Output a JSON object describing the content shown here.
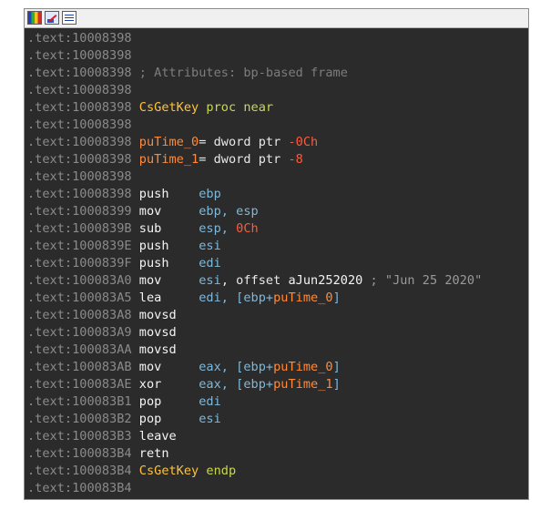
{
  "toolbar": {
    "icons": [
      "graph-view-icon",
      "edit-icon",
      "text-view-icon"
    ]
  },
  "lines": [
    {
      "addr": ".text:10008398",
      "parts": []
    },
    {
      "addr": ".text:10008398",
      "parts": []
    },
    {
      "addr": ".text:10008398",
      "parts": [
        {
          "t": " ; Attributes: bp-based frame",
          "c": "c-cmt"
        }
      ]
    },
    {
      "addr": ".text:10008398",
      "parts": []
    },
    {
      "addr": ".text:10008398",
      "parts": [
        {
          "t": " ",
          "c": "c-plain"
        },
        {
          "t": "CsGetKey",
          "c": "c-name"
        },
        {
          "t": " proc near",
          "c": "c-kw"
        }
      ]
    },
    {
      "addr": ".text:10008398",
      "parts": []
    },
    {
      "addr": ".text:10008398",
      "parts": [
        {
          "t": " ",
          "c": "c-plain"
        },
        {
          "t": "puTime_0",
          "c": "c-var"
        },
        {
          "t": "= dword ptr ",
          "c": "c-plain"
        },
        {
          "t": "-0Ch",
          "c": "c-neg"
        }
      ]
    },
    {
      "addr": ".text:10008398",
      "parts": [
        {
          "t": " ",
          "c": "c-plain"
        },
        {
          "t": "puTime_1",
          "c": "c-var"
        },
        {
          "t": "= dword ptr ",
          "c": "c-plain"
        },
        {
          "t": "-8",
          "c": "c-neg"
        }
      ]
    },
    {
      "addr": ".text:10008398",
      "parts": []
    },
    {
      "addr": ".text:10008398",
      "parts": [
        {
          "t": " push    ",
          "c": "c-mn"
        },
        {
          "t": "ebp",
          "c": "c-reg"
        }
      ]
    },
    {
      "addr": ".text:10008399",
      "parts": [
        {
          "t": " mov     ",
          "c": "c-mn"
        },
        {
          "t": "ebp, esp",
          "c": "c-reg"
        }
      ]
    },
    {
      "addr": ".text:1000839B",
      "parts": [
        {
          "t": " sub     ",
          "c": "c-mn"
        },
        {
          "t": "esp, ",
          "c": "c-reg"
        },
        {
          "t": "0Ch",
          "c": "c-num"
        }
      ]
    },
    {
      "addr": ".text:1000839E",
      "parts": [
        {
          "t": " push    ",
          "c": "c-mn"
        },
        {
          "t": "esi",
          "c": "c-reg"
        }
      ]
    },
    {
      "addr": ".text:1000839F",
      "parts": [
        {
          "t": " push    ",
          "c": "c-mn"
        },
        {
          "t": "edi",
          "c": "c-reg"
        }
      ]
    },
    {
      "addr": ".text:100083A0",
      "parts": [
        {
          "t": " mov     ",
          "c": "c-mn"
        },
        {
          "t": "esi",
          "c": "c-reg"
        },
        {
          "t": ", offset ",
          "c": "c-plain"
        },
        {
          "t": "aJun252020",
          "c": "c-strname"
        },
        {
          "t": " ; \"Jun 25 2020\"",
          "c": "c-str"
        }
      ]
    },
    {
      "addr": ".text:100083A5",
      "parts": [
        {
          "t": " lea     ",
          "c": "c-mn"
        },
        {
          "t": "edi, [ebp+",
          "c": "c-reg"
        },
        {
          "t": "puTime_0",
          "c": "c-var"
        },
        {
          "t": "]",
          "c": "c-reg"
        }
      ]
    },
    {
      "addr": ".text:100083A8",
      "parts": [
        {
          "t": " movsd",
          "c": "c-mn"
        }
      ]
    },
    {
      "addr": ".text:100083A9",
      "parts": [
        {
          "t": " movsd",
          "c": "c-mn"
        }
      ]
    },
    {
      "addr": ".text:100083AA",
      "parts": [
        {
          "t": " movsd",
          "c": "c-mn"
        }
      ]
    },
    {
      "addr": ".text:100083AB",
      "parts": [
        {
          "t": " mov     ",
          "c": "c-mn"
        },
        {
          "t": "eax, [ebp+",
          "c": "c-reg"
        },
        {
          "t": "puTime_0",
          "c": "c-var"
        },
        {
          "t": "]",
          "c": "c-reg"
        }
      ]
    },
    {
      "addr": ".text:100083AE",
      "parts": [
        {
          "t": " xor     ",
          "c": "c-mn"
        },
        {
          "t": "eax, [ebp+",
          "c": "c-reg"
        },
        {
          "t": "puTime_1",
          "c": "c-var"
        },
        {
          "t": "]",
          "c": "c-reg"
        }
      ]
    },
    {
      "addr": ".text:100083B1",
      "parts": [
        {
          "t": " pop     ",
          "c": "c-mn"
        },
        {
          "t": "edi",
          "c": "c-reg"
        }
      ]
    },
    {
      "addr": ".text:100083B2",
      "parts": [
        {
          "t": " pop     ",
          "c": "c-mn"
        },
        {
          "t": "esi",
          "c": "c-reg"
        }
      ]
    },
    {
      "addr": ".text:100083B3",
      "parts": [
        {
          "t": " leave",
          "c": "c-mn"
        }
      ]
    },
    {
      "addr": ".text:100083B4",
      "parts": [
        {
          "t": " retn",
          "c": "c-mn"
        }
      ]
    },
    {
      "addr": ".text:100083B4",
      "parts": [
        {
          "t": " ",
          "c": "c-plain"
        },
        {
          "t": "CsGetKey",
          "c": "c-name"
        },
        {
          "t": " endp",
          "c": "c-kw"
        }
      ]
    },
    {
      "addr": ".text:100083B4",
      "parts": []
    }
  ]
}
